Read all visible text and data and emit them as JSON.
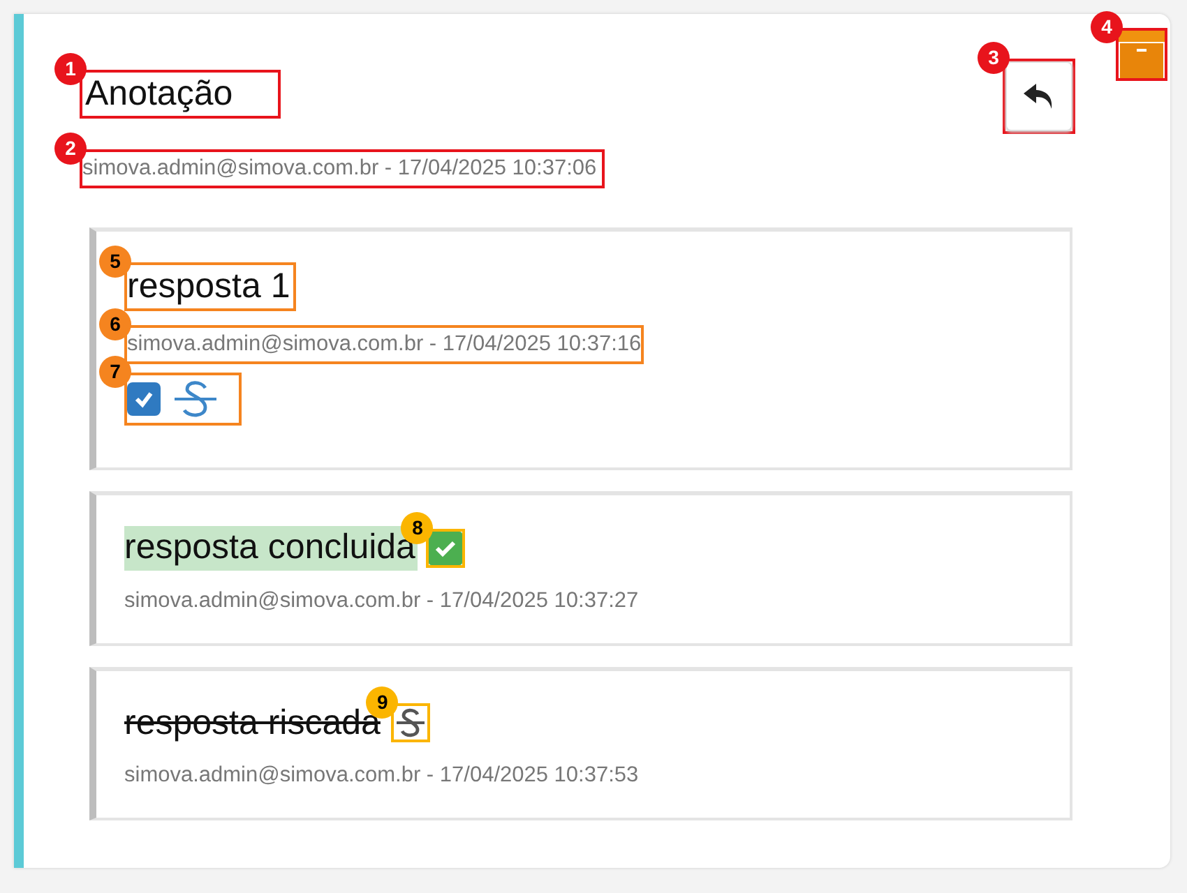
{
  "note": {
    "title": {
      "text": "Anotação",
      "callout": {
        "number": "1",
        "color": "#e8141c"
      }
    },
    "author_line": {
      "text": "simova.admin@simova.com.br - 17/04/2025 10:37:06",
      "callout": {
        "number": "2",
        "color": "#e8141c"
      }
    },
    "reply_button": {
      "callout": {
        "number": "3",
        "color": "#e8141c"
      }
    },
    "archive_button": {
      "callout": {
        "number": "4",
        "color": "#e8141c"
      }
    }
  },
  "replies": [
    {
      "kind": "open",
      "text": "resposta 1",
      "text_callout": {
        "number": "5",
        "color": "#f5841f"
      },
      "author_line": "simova.admin@simova.com.br - 17/04/2025 10:37:16",
      "author_callout": {
        "number": "6",
        "color": "#f5841f"
      },
      "checked": true,
      "actions_callout": {
        "number": "7",
        "color": "#f5841f"
      }
    },
    {
      "kind": "completed",
      "text": "resposta concluida",
      "author_line": "simova.admin@simova.com.br - 17/04/2025 10:37:27",
      "icon_callout": {
        "number": "8",
        "color": "#fbb500"
      }
    },
    {
      "kind": "struck",
      "text": "resposta riscada",
      "author_line": "simova.admin@simova.com.br - 17/04/2025 10:37:53",
      "icon_callout": {
        "number": "9",
        "color": "#fbb500"
      }
    }
  ]
}
